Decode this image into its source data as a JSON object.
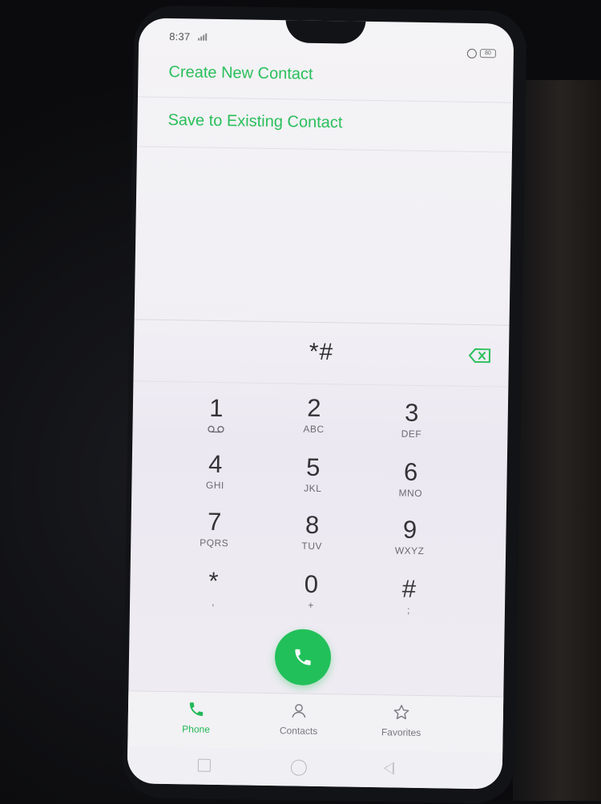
{
  "status_bar": {
    "time": "8:37",
    "battery": "80"
  },
  "menu": {
    "items": [
      {
        "label": "Create New Contact"
      },
      {
        "label": "Save to Existing Contact"
      }
    ]
  },
  "dialer": {
    "entered": "*#",
    "keys": [
      {
        "digit": "1",
        "letters": ""
      },
      {
        "digit": "2",
        "letters": "ABC"
      },
      {
        "digit": "3",
        "letters": "DEF"
      },
      {
        "digit": "4",
        "letters": "GHI"
      },
      {
        "digit": "5",
        "letters": "JKL"
      },
      {
        "digit": "6",
        "letters": "MNO"
      },
      {
        "digit": "7",
        "letters": "PQRS"
      },
      {
        "digit": "8",
        "letters": "TUV"
      },
      {
        "digit": "9",
        "letters": "WXYZ"
      },
      {
        "digit": "*",
        "letters": ","
      },
      {
        "digit": "0",
        "letters": "+"
      },
      {
        "digit": "#",
        "letters": ";"
      }
    ]
  },
  "tabs": [
    {
      "label": "Phone",
      "icon": "phone-icon",
      "active": true
    },
    {
      "label": "Contacts",
      "icon": "person-icon",
      "active": false
    },
    {
      "label": "Favorites",
      "icon": "star-icon",
      "active": false
    }
  ],
  "colors": {
    "accent": "#22c05a",
    "menu_text": "#2bbf5b"
  }
}
